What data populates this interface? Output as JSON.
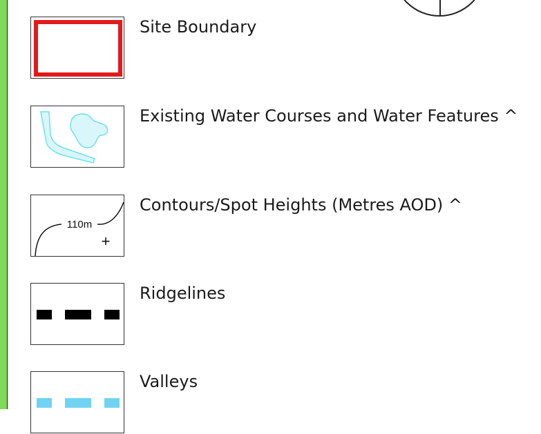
{
  "legend": {
    "items": [
      {
        "key": "site_boundary",
        "label": "Site Boundary",
        "color": "#e31a1c"
      },
      {
        "key": "water_courses",
        "label": "Existing Water Courses and Water Features  ^",
        "color": "#6fe0ea"
      },
      {
        "key": "contours",
        "label": "Contours/Spot Heights (Metres AOD) ^",
        "contour_value": "110m",
        "spot_symbol": "+",
        "color": "#111111"
      },
      {
        "key": "ridgelines",
        "label": "Ridgelines",
        "color": "#000000"
      },
      {
        "key": "valleys",
        "label": "Valleys",
        "color": "#6fd3f1"
      }
    ]
  },
  "north_arrow": {
    "icon": "north-arrow-icon"
  }
}
